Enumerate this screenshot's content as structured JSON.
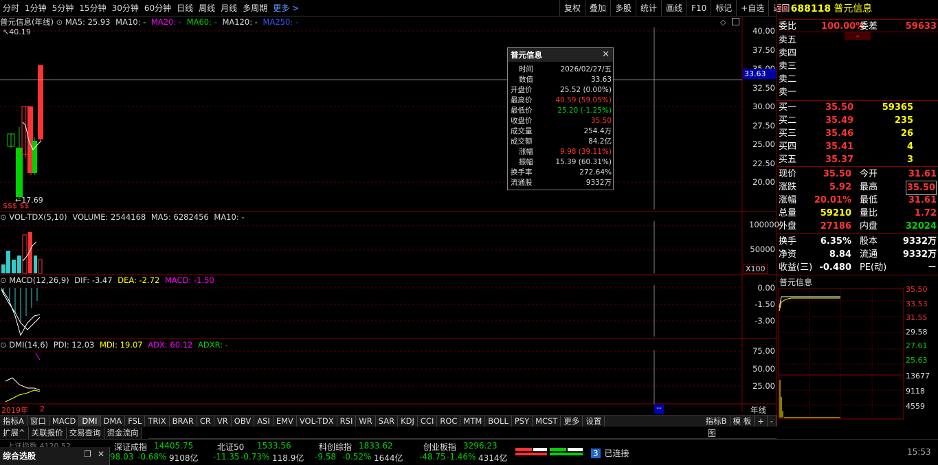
{
  "toolbar": {
    "periods": [
      "分时",
      "1分钟",
      "5分钟",
      "15分钟",
      "30分钟",
      "60分钟",
      "日线",
      "周线",
      "月线",
      "多周期",
      "更多 >"
    ],
    "right": [
      "复权",
      "叠加",
      "多股",
      "统计",
      "画线",
      "F10",
      "标记",
      "+自选",
      "返回"
    ]
  },
  "main": {
    "title": "普元信息(年线)",
    "ma5": "MA5: 25.93",
    "ma10": "MA10: -",
    "ma20": "MA20: -",
    "ma60": "MA60: -",
    "ma120": "MA120: -",
    "ma250": "MA250: -",
    "high_label": "40.19",
    "low_label": "17.69",
    "cursor_price": "33.63",
    "yticks": [
      "40.00",
      "37.50",
      "35.00",
      "32.50",
      "30.00",
      "27.50",
      "25.00",
      "22.50",
      "20.00"
    ],
    "sss": "$$$ $$"
  },
  "volume": {
    "title": "VOL-TDX(5,10)",
    "vol": "VOLUME: 2544168",
    "ma5": "MA5: 6282456",
    "ma10": "MA10: -",
    "yticks": [
      "100000",
      "50000"
    ],
    "unit": "X100"
  },
  "macd": {
    "title": "MACD(12,26,9)",
    "dif": "DIF: -3.47",
    "dea": "DEA: -2.72",
    "macd": "MACD: -1.50",
    "yticks": [
      "0.00",
      "-1.50",
      "-3.00"
    ]
  },
  "dmi": {
    "title": "DMI(14,6)",
    "pdi": "PDI: 12.03",
    "mdi": "MDI: 19.07",
    "adx": "ADX: 60.12",
    "adxr": "ADXR: -",
    "yticks": [
      "75.00",
      "50.00",
      "25.00"
    ]
  },
  "xaxis": {
    "year": "2019年",
    "n": "2",
    "cursor": "--",
    "unit": "年线"
  },
  "tooltip": {
    "title": "普元信息",
    "rows": [
      {
        "k": "时间",
        "v": "2026/02/27/五",
        "c": "#ddd"
      },
      {
        "k": "数值",
        "v": "33.63",
        "c": "#ddd"
      },
      {
        "k": "开盘价",
        "v": "25.52 (0.00%)",
        "c": "#ddd"
      },
      {
        "k": "最高价",
        "v": "40.59 (59.05%)",
        "c": "#ff3333"
      },
      {
        "k": "最低价",
        "v": "25.20 (-1.25%)",
        "c": "#00d200"
      },
      {
        "k": "收盘价",
        "v": "35.50",
        "c": "#ff3333"
      },
      {
        "k": "成交量",
        "v": "254.4万",
        "c": "#ddd"
      },
      {
        "k": "成交额",
        "v": "84.2亿",
        "c": "#ddd"
      },
      {
        "k": "涨幅",
        "v": "9.98 (39.11%)",
        "c": "#ff3333"
      },
      {
        "k": "振幅",
        "v": "15.39 (60.31%)",
        "c": "#ddd"
      },
      {
        "k": "换手率",
        "v": "272.64%",
        "c": "#ddd"
      },
      {
        "k": "流通股",
        "v": "9332万",
        "c": "#ddd"
      }
    ]
  },
  "tabs": [
    "指标A",
    "窗口",
    "MACD",
    "DMI",
    "DMA",
    "FSL",
    "TRIX",
    "BRAR",
    "CR",
    "VR",
    "OBV",
    "ASI",
    "EMV",
    "VOL-TDX",
    "RSI",
    "WR",
    "SAR",
    "KDJ",
    "CCI",
    "ROC",
    "MTM",
    "BOLL",
    "PSY",
    "MCST",
    "更多",
    "设置"
  ],
  "tabs_right": [
    "指标B",
    "模 板",
    "+",
    "-"
  ],
  "subtabs": [
    "扩展^",
    "关联报价",
    "交易查询",
    "资金流向"
  ],
  "stock": {
    "badge": "KR",
    "code": "688118",
    "name": "普元信息"
  },
  "order": {
    "weibi_label": "委比",
    "weibi": "100.00%",
    "weicha_label": "委差",
    "weicha": "59633",
    "sells": [
      "卖五",
      "卖四",
      "卖三",
      "卖二",
      "卖一"
    ],
    "buys": [
      {
        "l": "买一",
        "p": "35.50",
        "v": "59365"
      },
      {
        "l": "买二",
        "p": "35.49",
        "v": "235"
      },
      {
        "l": "买三",
        "p": "35.46",
        "v": "26"
      },
      {
        "l": "买四",
        "p": "35.41",
        "v": "4"
      },
      {
        "l": "买五",
        "p": "35.37",
        "v": "3"
      }
    ]
  },
  "quote": {
    "xianjia_l": "现价",
    "xianjia": "35.50",
    "jinkai_l": "今开",
    "jinkai": "31.61",
    "zhangdie_l": "涨跌",
    "zhangdie": "5.92",
    "zuigao_l": "最高",
    "zuigao": "35.50",
    "zhangfu_l": "涨幅",
    "zhangfu": "20.01%",
    "zuidi_l": "最低",
    "zuidi": "31.61",
    "zongliang_l": "总量",
    "zongliang": "59210",
    "liangbi_l": "量比",
    "liangbi": "1.72",
    "waipan_l": "外盘",
    "waipan": "27186",
    "neipan_l": "内盘",
    "neipan": "32024",
    "huanshou_l": "换手",
    "huanshou": "6.35%",
    "guben_l": "股本",
    "guben": "9332万",
    "jingzi_l": "净资",
    "jingzi": "8.84",
    "liutong_l": "流通",
    "liutong": "9332万",
    "shouyi_l": "收益(三)",
    "shouyi": "-0.480",
    "pe_l": "PE(动)",
    "pe": "－"
  },
  "mini": {
    "title": "普元信息",
    "prices": [
      "35.50",
      "33.53",
      "31.55",
      "29.58",
      "27.61",
      "25.63"
    ],
    "vols": [
      "13677",
      "9118",
      "4559"
    ],
    "cursor": "图"
  },
  "status": {
    "panel": "综合选股",
    "idx": [
      {
        "name": "深证成指",
        "val": "14405.75",
        "chg": "98.03",
        "pct": "-0.68%",
        "amt": "9108亿"
      },
      {
        "name": "北证50",
        "val": "1533.56",
        "chg": "-11.35",
        "pct": "-0.73%",
        "amt": "118.9亿"
      },
      {
        "name": "科创综指",
        "val": "1833.62",
        "chg": "-9.58",
        "pct": "-0.52%",
        "amt": "1644亿"
      },
      {
        "name": "创业板指",
        "val": "3296.23",
        "chg": "-48.75",
        "pct": "-1.46%",
        "amt": "4314亿"
      }
    ],
    "first_row": "上证指数 4120.52",
    "conn_num": "3",
    "conn": "已连接",
    "time": "15:53"
  }
}
